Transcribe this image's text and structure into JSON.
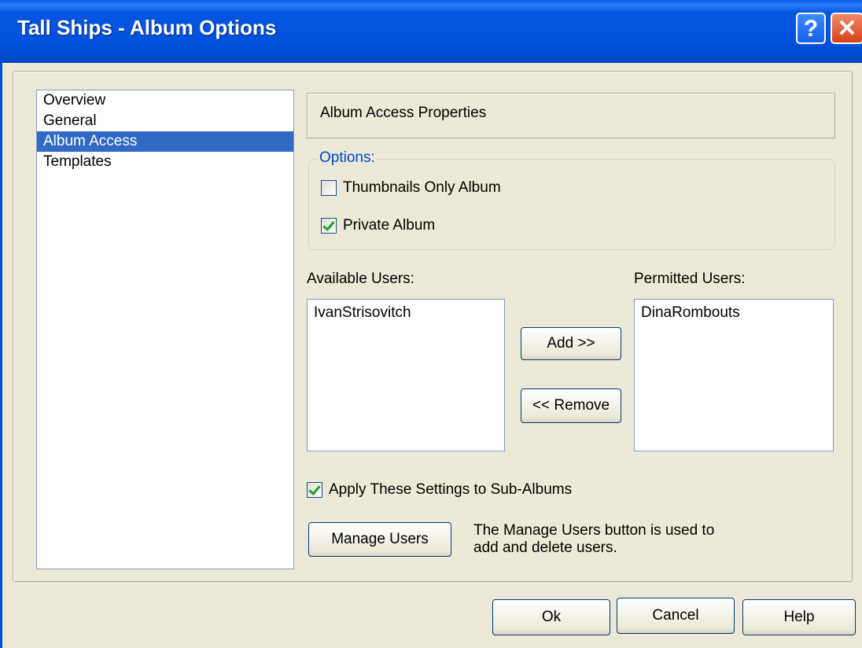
{
  "window": {
    "title": "Tall Ships - Album Options",
    "help_glyph": "?",
    "close_glyph": "✕"
  },
  "nav": {
    "items": [
      {
        "label": "Overview",
        "selected": false
      },
      {
        "label": "General",
        "selected": false
      },
      {
        "label": "Album Access",
        "selected": true
      },
      {
        "label": "Templates",
        "selected": false
      }
    ]
  },
  "panel": {
    "header": "Album Access Properties",
    "options_legend": "Options:",
    "thumbnails_only": {
      "label": "Thumbnails Only Album",
      "checked": false
    },
    "private_album": {
      "label": "Private Album",
      "checked": true
    },
    "available_users_label": "Available Users:",
    "available_users": [
      "IvanStrisovitch"
    ],
    "permitted_users_label": "Permitted Users:",
    "permitted_users": [
      "DinaRombouts"
    ],
    "add_button": "Add >>",
    "remove_button": "<< Remove",
    "apply_sub_albums": {
      "label": "Apply These Settings to Sub-Albums",
      "checked": true
    },
    "manage_users_button": "Manage Users",
    "manage_users_note_line1": "The Manage Users button is used to",
    "manage_users_note_line2": "add and delete users."
  },
  "footer": {
    "ok_button": "Ok",
    "cancel_button": "Cancel",
    "help_button": "Help"
  },
  "colors": {
    "titlebar": "#0050da",
    "selection": "#316ac5",
    "legend_text": "#0046d5",
    "checkmark": "#21a121"
  }
}
